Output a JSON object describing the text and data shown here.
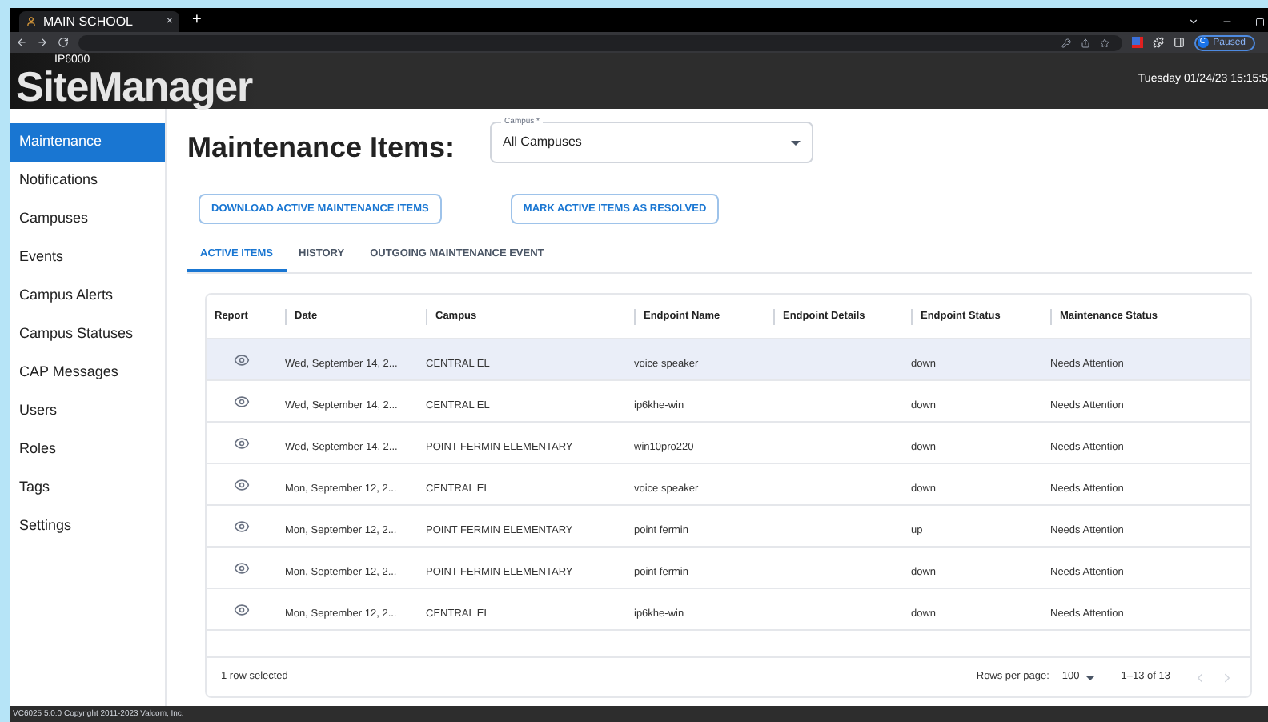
{
  "browser": {
    "tab_title": "MAIN SCHOOL",
    "tab_close": "×",
    "new_tab": "+",
    "profile_initial": "C",
    "profile_status": "Paused"
  },
  "header": {
    "product_line": "IP6000",
    "logo": "SiteManager",
    "datetime": "Tuesday 01/24/23 15:15:5"
  },
  "sidebar": {
    "items": [
      {
        "label": "Maintenance",
        "selected": true
      },
      {
        "label": "Notifications",
        "selected": false
      },
      {
        "label": "Campuses",
        "selected": false
      },
      {
        "label": "Events",
        "selected": false
      },
      {
        "label": "Campus Alerts",
        "selected": false
      },
      {
        "label": "Campus Statuses",
        "selected": false
      },
      {
        "label": "CAP Messages",
        "selected": false
      },
      {
        "label": "Users",
        "selected": false
      },
      {
        "label": "Roles",
        "selected": false
      },
      {
        "label": "Tags",
        "selected": false
      },
      {
        "label": "Settings",
        "selected": false
      }
    ]
  },
  "page": {
    "title": "Maintenance Items:",
    "campus_select": {
      "label": "Campus *",
      "value": "All Campuses"
    },
    "buttons": [
      "DOWNLOAD ACTIVE MAINTENANCE ITEMS",
      "MARK ACTIVE ITEMS AS RESOLVED"
    ],
    "tabs": [
      {
        "label": "ACTIVE ITEMS",
        "selected": true
      },
      {
        "label": "HISTORY",
        "selected": false
      },
      {
        "label": "OUTGOING MAINTENANCE EVENT",
        "selected": false
      }
    ]
  },
  "table": {
    "columns": [
      "Report",
      "Date",
      "Campus",
      "Endpoint Name",
      "Endpoint Details",
      "Endpoint Status",
      "Maintenance Status"
    ],
    "rows": [
      {
        "selected": true,
        "date": "Wed, September 14, 2...",
        "campus": "CENTRAL EL",
        "endpoint_name": "voice speaker",
        "endpoint_status": "down",
        "maintenance_status": "Needs Attention"
      },
      {
        "selected": false,
        "date": "Wed, September 14, 2...",
        "campus": "CENTRAL EL",
        "endpoint_name": "ip6khe-win",
        "endpoint_status": "down",
        "maintenance_status": "Needs Attention"
      },
      {
        "selected": false,
        "date": "Wed, September 14, 2...",
        "campus": "POINT FERMIN ELEMENTARY",
        "endpoint_name": "win10pro220",
        "endpoint_status": "down",
        "maintenance_status": "Needs Attention"
      },
      {
        "selected": false,
        "date": "Mon, September 12, 2...",
        "campus": "CENTRAL EL",
        "endpoint_name": "voice speaker",
        "endpoint_status": "down",
        "maintenance_status": "Needs Attention"
      },
      {
        "selected": false,
        "date": "Mon, September 12, 2...",
        "campus": "POINT FERMIN ELEMENTARY",
        "endpoint_name": "point fermin",
        "endpoint_status": "up",
        "maintenance_status": "Needs Attention"
      },
      {
        "selected": false,
        "date": "Mon, September 12, 2...",
        "campus": "POINT FERMIN ELEMENTARY",
        "endpoint_name": "point fermin",
        "endpoint_status": "down",
        "maintenance_status": "Needs Attention"
      },
      {
        "selected": false,
        "date": "Mon, September 12, 2...",
        "campus": "CENTRAL EL",
        "endpoint_name": "ip6khe-win",
        "endpoint_status": "down",
        "maintenance_status": "Needs Attention"
      }
    ],
    "footer": {
      "selection": "1 row selected",
      "rows_per_page_label": "Rows per page:",
      "rows_per_page_value": "100",
      "range": "1–13 of 13"
    }
  },
  "footer_text": "VC6025 5.0.0 Copyright 2011-2023 Valcom, Inc."
}
